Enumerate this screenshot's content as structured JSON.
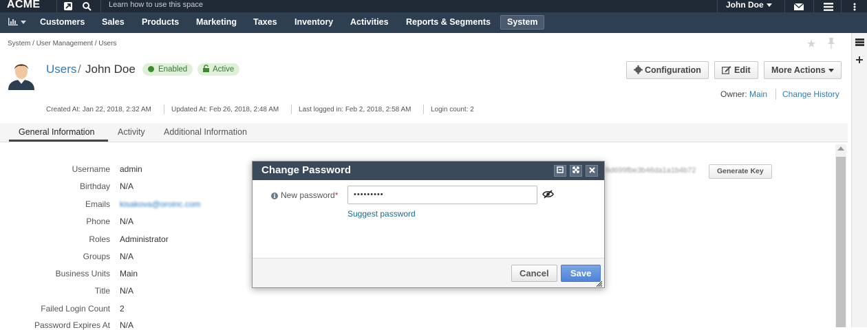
{
  "topbar": {
    "brand": "ACME",
    "search_hint": "Learn how to use this space",
    "user_name": "John Doe"
  },
  "nav": {
    "items": [
      "Customers",
      "Sales",
      "Products",
      "Marketing",
      "Taxes",
      "Inventory",
      "Activities",
      "Reports & Segments",
      "System"
    ],
    "active": "System"
  },
  "breadcrumb": {
    "items": [
      "System",
      "User Management",
      "Users"
    ],
    "separator": "/"
  },
  "header": {
    "entity": "Users",
    "separator": "/",
    "name": "John Doe",
    "badges": [
      "Enabled",
      "Active"
    ],
    "buttons": {
      "configuration": "Configuration",
      "edit": "Edit",
      "more_actions": "More Actions"
    },
    "owner_label": "Owner:",
    "owner_value": "Main",
    "change_history": "Change History"
  },
  "meta": {
    "created": "Created At: Jan 22, 2018, 2:32 AM",
    "updated": "Updated At: Feb 26, 2018, 2:48 AM",
    "last_login": "Last logged in: Feb 2, 2018, 2:58 AM",
    "login_count": "Login count: 2"
  },
  "tabs": [
    "General Information",
    "Activity",
    "Additional Information"
  ],
  "fields": [
    {
      "label": "Username",
      "value": "admin"
    },
    {
      "label": "Birthday",
      "value": "N/A"
    },
    {
      "label": "Emails",
      "value": "kisakova@oroinc.com"
    },
    {
      "label": "Phone",
      "value": "N/A"
    },
    {
      "label": "Roles",
      "value": "Administrator"
    },
    {
      "label": "Groups",
      "value": "N/A"
    },
    {
      "label": "Business Units",
      "value": "Main"
    },
    {
      "label": "Title",
      "value": "N/A"
    },
    {
      "label": "Failed Login Count",
      "value": "2"
    },
    {
      "label": "Password Expires At",
      "value": "N/A"
    }
  ],
  "api_key": {
    "value": "8d699fbe3b46da1a1b4b72",
    "button": "Generate Key"
  },
  "dialog": {
    "title": "Change Password",
    "field_label": "New password",
    "required_mark": "*",
    "password_value": "•••••••••",
    "suggest": "Suggest password",
    "cancel": "Cancel",
    "save": "Save"
  },
  "colors": {
    "topbar": "#1f2a36",
    "nav": "#2f3f52",
    "link": "#2b7bbf",
    "badge_bg": "#dff0d8",
    "save": "#4f82d6"
  }
}
